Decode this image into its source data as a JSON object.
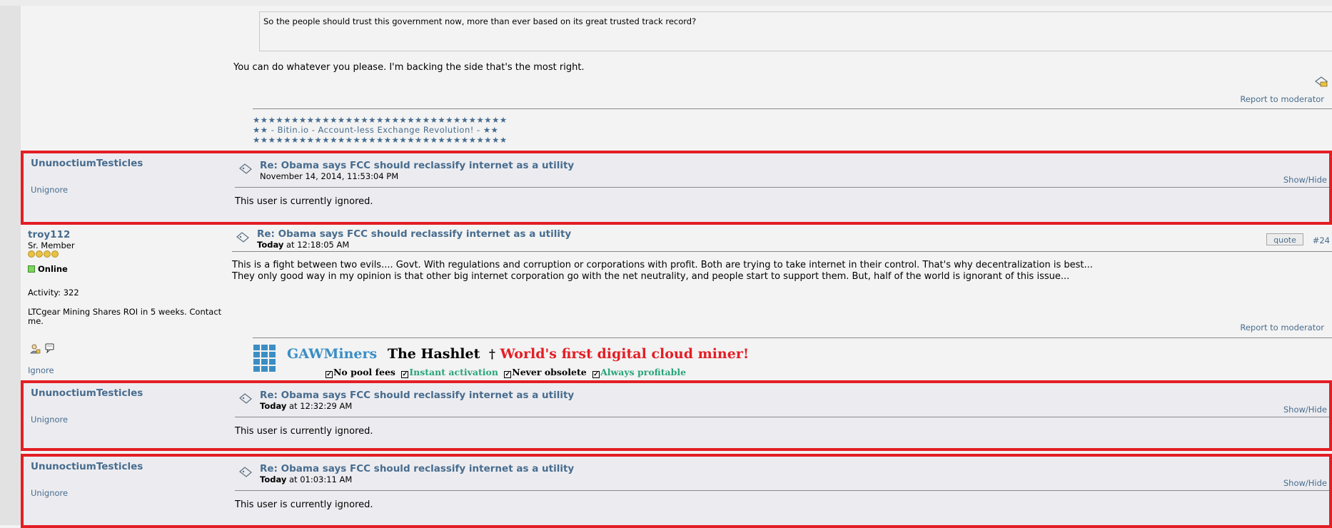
{
  "colors": {
    "accent_link": "#476c8e",
    "highlight_border": "#e31e24",
    "online": "#7ed65a",
    "gaw_blue": "#3a8ec4",
    "gaw_red": "#e31e24",
    "gaw_green": "#27a37a"
  },
  "top_post": {
    "quote_text": "So the people should trust this government now, more than ever based on its great trusted track record?",
    "body": "You can do whatever you please. I'm backing the side that's the most right.",
    "report_label": "Report to moderator",
    "signature": [
      "★★★★★★★★★★★★★★★★★★★★★★★★★★★★★★★★★",
      "★★ - Bitin.io - Account-less Exchange Revolution! - ★★",
      "★★★★★★★★★★★★★★★★★★★★★★★★★★★★★★★★★"
    ]
  },
  "ignored_post_1": {
    "author": "UnunoctiumTesticles",
    "action": "Unignore",
    "subject": "Re: Obama says FCC should reclassify internet as a utility",
    "date": "November 14, 2014, 11:53:04 PM",
    "showhide": "Show/Hide",
    "body": "This user is currently ignored."
  },
  "troy_post": {
    "author": "troy112",
    "rank": "Sr. Member",
    "status": "Online",
    "activity": "Activity: 322",
    "custom_text_1": "LTCgear Mining Shares ROI in 5 weeks. Contact",
    "custom_text_2": "me.",
    "ignore_label": "Ignore",
    "subject": "Re: Obama says FCC should reclassify internet as a utility",
    "date_prefix": "Today",
    "date_suffix": " at 12:18:05 AM",
    "quote_label": "quote",
    "post_number": "#24",
    "body_line_1": "This is a fight between two evils.... Govt. With regulations and corruption or corporations with profit. Both are trying to take internet in their control. That's why decentralization is best...",
    "body_line_2": "They only good way in my opinion is that other big internet corporation go with the net neutrality, and people start to support them. But, half of the world is ignorant of this issue...",
    "report_label": "Report to moderator",
    "gaw_brand": "GAWMiners",
    "gaw_product": "The Hashlet",
    "gaw_dagger": "†",
    "gaw_slogan": "World's first digital cloud miner!",
    "gaw_features": [
      "No pool fees",
      "Instant activation",
      "Never obsolete",
      "Always profitable"
    ]
  },
  "ignored_post_2": {
    "author": "UnunoctiumTesticles",
    "action": "Unignore",
    "subject": "Re: Obama says FCC should reclassify internet as a utility",
    "date_prefix": "Today",
    "date_suffix": " at 12:32:29 AM",
    "showhide": "Show/Hide",
    "body": "This user is currently ignored."
  },
  "ignored_post_3": {
    "author": "UnunoctiumTesticles",
    "action": "Unignore",
    "subject": "Re: Obama says FCC should reclassify internet as a utility",
    "date_prefix": "Today",
    "date_suffix": " at 01:03:11 AM",
    "showhide": "Show/Hide",
    "body": "This user is currently ignored."
  }
}
